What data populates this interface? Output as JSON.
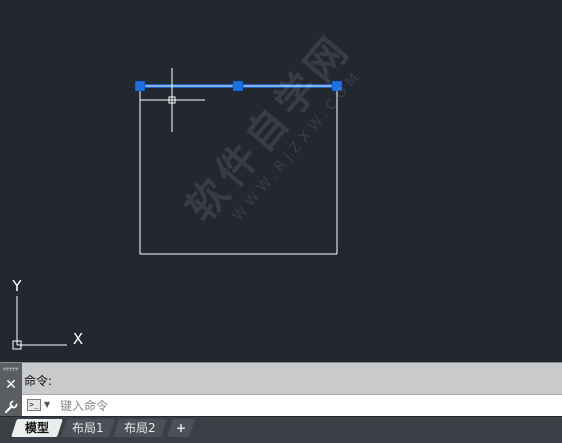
{
  "drawing": {
    "ucs_y_label": "Y",
    "ucs_x_label": "X",
    "grip_color": "#1e6fe0",
    "selected_line_color": "#4aa3ff",
    "line_color": "#ffffff"
  },
  "watermark": {
    "main": "软件自学网",
    "sub": "WWW.RJZXW.COM"
  },
  "command": {
    "history_text": "命令:",
    "input_placeholder": "键入命令",
    "close_icon": "close-icon",
    "settings_icon": "wrench-icon"
  },
  "tabs": [
    {
      "label": "模型",
      "active": true
    },
    {
      "label": "布局1",
      "active": false
    },
    {
      "label": "布局2",
      "active": false
    },
    {
      "label": "+",
      "active": false
    }
  ]
}
